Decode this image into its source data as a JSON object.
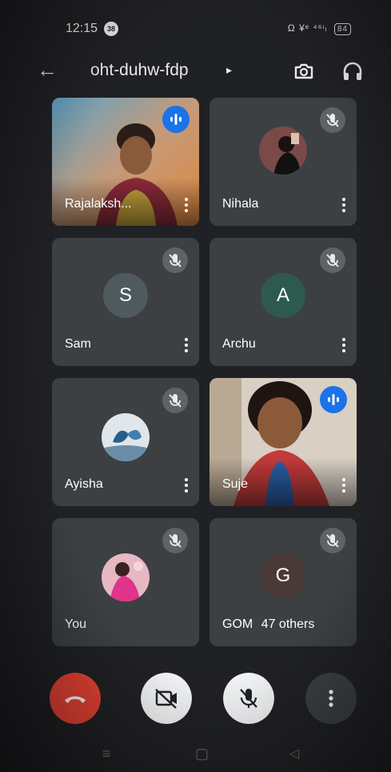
{
  "status_bar": {
    "time": "12:15",
    "notification_badge": "38",
    "system_icons": "Ω ¥ᵉ ⁴⁶ᶦₗ",
    "battery": "84"
  },
  "header": {
    "meeting_code": "oht-duhw-fdp",
    "caret": "▸"
  },
  "participants": [
    {
      "name": "Rajalaksh...",
      "type": "video",
      "state": "speaking"
    },
    {
      "name": "Nihala",
      "type": "photo",
      "state": "muted"
    },
    {
      "name": "Sam",
      "type": "letter",
      "letter": "S",
      "color": "#4f5a5e",
      "state": "muted"
    },
    {
      "name": "Archu",
      "type": "letter",
      "letter": "A",
      "color": "#2d5a4e",
      "state": "muted"
    },
    {
      "name": "Ayisha",
      "type": "photo",
      "state": "muted"
    },
    {
      "name": "Suje",
      "type": "video",
      "state": "speaking"
    },
    {
      "name": "You",
      "type": "photo",
      "state": "muted"
    },
    {
      "name": "GOM",
      "type": "letter",
      "letter": "G",
      "color": "#4a3a36",
      "state": "muted",
      "others": "47 others"
    }
  ],
  "controls": {
    "end_call_color": "#ea4335",
    "camera_off_color": "#f1f3f4",
    "mic_off_color": "#f1f3f4",
    "more_color": "#3c4043"
  },
  "nav_bar": {
    "menu": "≡",
    "home": "▢",
    "back": "◁"
  }
}
